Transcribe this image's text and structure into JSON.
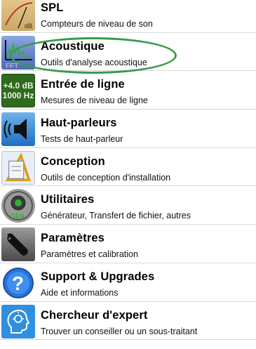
{
  "items": [
    {
      "title": "SPL",
      "subtitle": "Compteurs de niveau de son",
      "icon": "spl-meter-icon"
    },
    {
      "title": "Acoustique",
      "subtitle": "Outils d'analyse acoustique",
      "icon": "fft-analyzer-icon"
    },
    {
      "title": "Entrée de ligne",
      "subtitle": "Mesures de niveau de ligne",
      "icon": "line-level-display-icon",
      "icon_text": [
        "+4.0 dB",
        "1000 Hz"
      ]
    },
    {
      "title": "Haut-parleurs",
      "subtitle": "Tests de haut-parleur",
      "icon": "speaker-icon"
    },
    {
      "title": "Conception",
      "subtitle": "Outils de conception d'installation",
      "icon": "design-tools-icon"
    },
    {
      "title": "Utilitaires",
      "subtitle": "Générateur, Transfert de fichier, autres",
      "icon": "utilities-gen-icon",
      "icon_text": [
        "GEN"
      ]
    },
    {
      "title": "Paramètres",
      "subtitle": "Paramètres et calibration",
      "icon": "wrench-icon"
    },
    {
      "title": "Support & Upgrades",
      "subtitle": "Aide et informations",
      "icon": "help-question-icon"
    },
    {
      "title": "Chercheur d'expert",
      "subtitle": "Trouver un conseiller ou un sous-traitant",
      "icon": "lightbulb-head-icon"
    }
  ],
  "colors": {
    "highlight": "#3a9a4a",
    "divider": "#d9d9d9"
  }
}
